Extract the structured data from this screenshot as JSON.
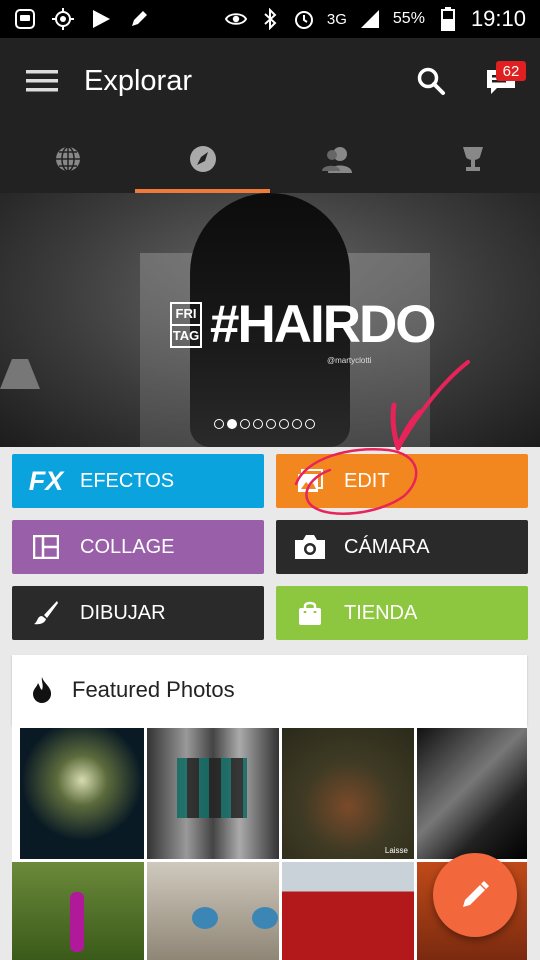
{
  "status_bar": {
    "battery": "55%",
    "time": "19:10",
    "network": "3G",
    "icons": [
      "app-notification-icon",
      "gps-icon",
      "play-icon",
      "edit-icon",
      "eye-icon",
      "bluetooth-icon",
      "alarm-icon",
      "signal-icon",
      "battery-icon"
    ]
  },
  "app_bar": {
    "title": "Explorar",
    "notification_count": "62",
    "icons": [
      "menu-icon",
      "search-icon",
      "messages-icon"
    ]
  },
  "tabs": [
    {
      "icon": "globe-icon",
      "active": false
    },
    {
      "icon": "compass-icon",
      "active": true
    },
    {
      "icon": "people-icon",
      "active": false
    },
    {
      "icon": "trophy-icon",
      "active": false
    }
  ],
  "banner": {
    "tag_top": "FRI",
    "tag_bottom": "TAG",
    "hashtag": "#HAIRDO",
    "handle": "@martyclotti",
    "slide_count": 8,
    "active_slide": 1
  },
  "actions": {
    "efectos": {
      "label": "EFECTOS",
      "icon_text": "FX",
      "color": "#0aa3de"
    },
    "edit": {
      "label": "EDIT",
      "color": "#f2871f"
    },
    "collage": {
      "label": "COLLAGE",
      "color": "#9a5fa9"
    },
    "camara": {
      "label": "CÁMARA",
      "color": "#2a2a2a"
    },
    "dibujar": {
      "label": "DIBUJAR",
      "color": "#2a2a2a"
    },
    "tienda": {
      "label": "TIENDA",
      "color": "#8dc63f"
    }
  },
  "featured": {
    "title": "Featured Photos",
    "photo_credit": "Laisse"
  },
  "colors": {
    "accent": "#f07a3a",
    "annotation": "#e8235a",
    "fab": "#f2683c"
  }
}
